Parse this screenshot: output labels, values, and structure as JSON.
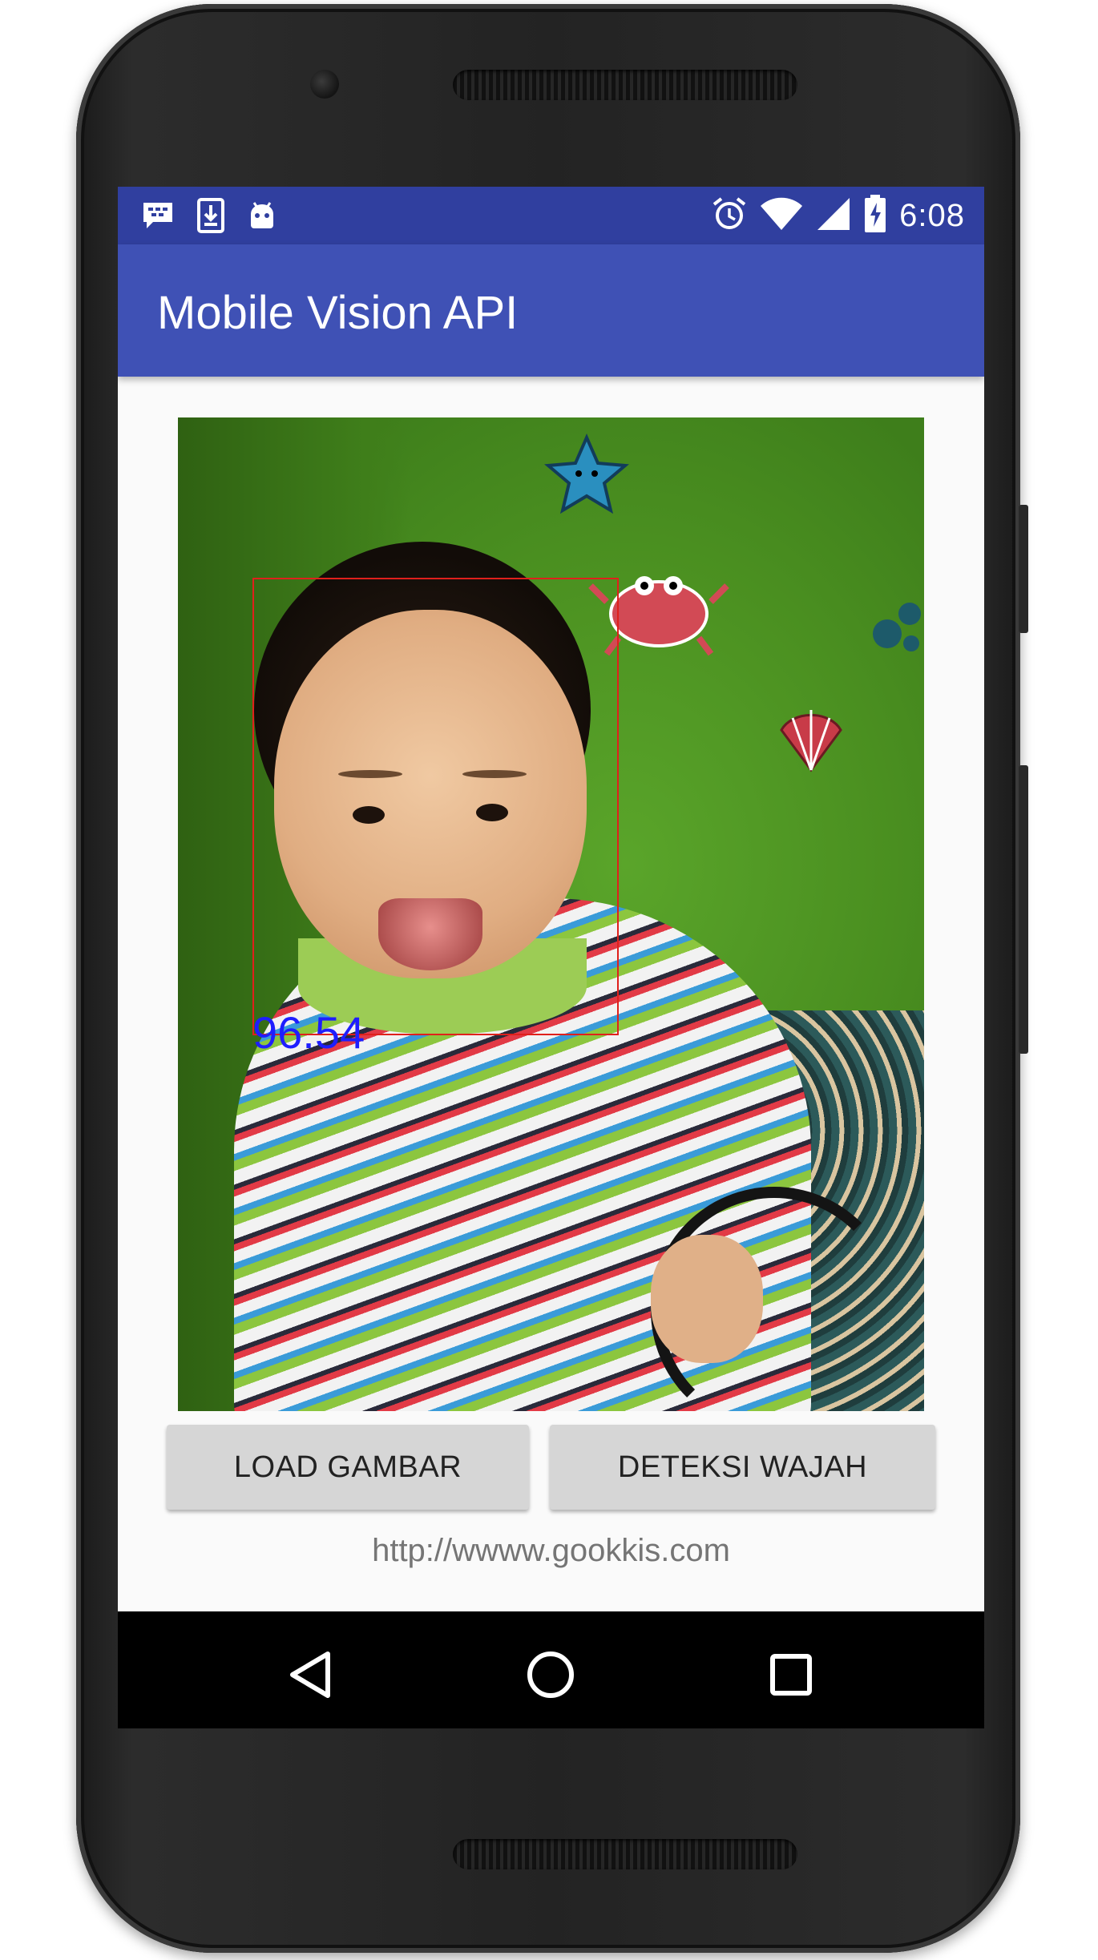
{
  "status_bar": {
    "time": "6:08",
    "left_icons": [
      "bbm-notification-icon",
      "download-icon",
      "android-icon"
    ],
    "right_icons": [
      "alarm-icon",
      "wifi-icon",
      "cell-signal-icon",
      "battery-charging-icon"
    ]
  },
  "app_bar": {
    "title": "Mobile Vision API"
  },
  "main": {
    "detection": {
      "confidence": "96.54"
    },
    "buttons": {
      "load": "LOAD GAMBAR",
      "detect": "DETEKSI WAJAH"
    },
    "link": "http://wwww.gookkis.com"
  },
  "nav_bar": {
    "icons": [
      "back-icon",
      "home-icon",
      "recents-icon"
    ]
  },
  "colors": {
    "status_bar": "#303F9F",
    "app_bar": "#3F51B5",
    "button_bg": "#D6D6D6",
    "face_box": "#E0201C",
    "confidence_text": "#1E1EFF"
  }
}
